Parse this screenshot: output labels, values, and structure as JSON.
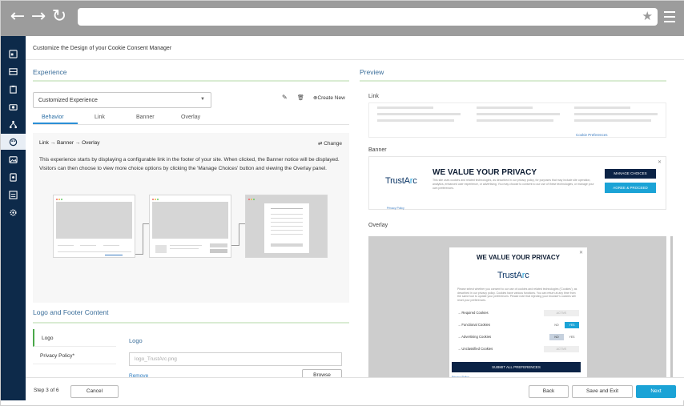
{
  "page_title": "Customize the Design of your Cookie Consent Manager",
  "experience": {
    "title": "Experience",
    "select_value": "Customized Experience",
    "create_new_label": "Create New",
    "tabs": [
      "Behavior",
      "Link",
      "Banner",
      "Overlay"
    ],
    "active_tab": "Behavior",
    "flow_title": "Link → Banner → Overlay",
    "change_label": "Change",
    "description": "This experience starts by displaying a configurable link in the footer of your site. When clicked, the Banner notice will be displayed. Visitors can then choose to view more choice options by clicking the 'Manage Choices' button and viewing the Overlay panel."
  },
  "logo_footer": {
    "title": "Logo and Footer Content",
    "items": [
      "Logo",
      "Privacy Policy*"
    ],
    "field_label": "Logo",
    "field_value": "logo_TrustArc.png",
    "remove_label": "Remove",
    "browse_label": "Browse"
  },
  "preview": {
    "title": "Preview",
    "link_label": "Link",
    "cookie_pref_link": "Cookie Preferences",
    "banner_label": "Banner",
    "overlay_label": "Overlay",
    "brand_left": "TrustA",
    "brand_o": "r",
    "brand_right": "c",
    "banner": {
      "title": "WE VALUE YOUR PRIVACY",
      "text": "This site uses cookies and related technologies, as described in our privacy policy, for purposes that may include site operation, analytics, enhanced user experience, or advertising. You may choose to consent to our use of these technologies, or manage your own preferences.",
      "manage_btn": "MANAGE CHOICES",
      "agree_btn": "AGREE & PROCEED",
      "privacy": "Privacy Policy"
    },
    "overlay": {
      "title": "WE VALUE YOUR PRIVACY",
      "text": "Please select whether you consent to our use of cookies and related technologies ('Cookies'), as described in our privacy policy. Cookies have various functions. You can return at any time from the same tool to update your preferences. Please note that rejecting your browser's cookies will reset your preferences.",
      "rows": [
        {
          "label": "Required Cookies",
          "state": "ACTIVE"
        },
        {
          "label": "Functional Cookies",
          "no": "NO",
          "yes": "YES"
        },
        {
          "label": "Advertising Cookies",
          "no": "NO",
          "yes": "YES"
        },
        {
          "label": "Unclassified Cookies",
          "state": "ACTIVE"
        }
      ],
      "submit": "SUBMIT ALL PREFERENCES",
      "privacy": "Privacy Policy"
    }
  },
  "footer": {
    "step": "Step 3 of 6",
    "cancel": "Cancel",
    "back": "Back",
    "save_exit": "Save and Exit",
    "next": "Next"
  },
  "colors": {
    "sidebar": "#0d2a4a",
    "accent": "#1ba3d6",
    "section_title": "#3b6e9a",
    "section_rule": "#d9ecd3"
  },
  "icons": [
    "back-arrow-icon",
    "forward-arrow-icon",
    "refresh-icon",
    "star-icon",
    "hamburger-menu-icon",
    "edit-icon",
    "trash-icon",
    "plus-circle-icon",
    "swap-icon",
    "close-icon"
  ]
}
